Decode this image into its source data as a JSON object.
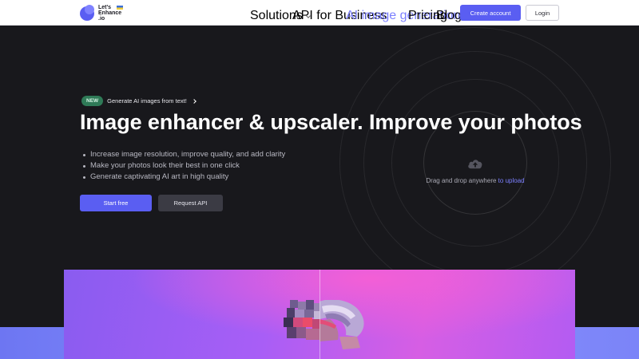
{
  "header": {
    "logo_text": "Let's\nEnhance\n.io",
    "nav": [
      {
        "label": "Solutions",
        "has_dropdown": true
      },
      {
        "label": "API for Business"
      },
      {
        "label": "AI image generation",
        "active": true
      },
      {
        "label": "Pricing"
      },
      {
        "label": "Blog"
      }
    ],
    "create_account": "Create account",
    "login": "Login"
  },
  "hero": {
    "badge": "NEW",
    "badge_text": "Generate AI images from text!",
    "headline": "Image enhancer & upscaler.  Improve your photos",
    "bullets": [
      "Increase image resolution, improve quality, and add clarity",
      "Make your photos look their best in one click",
      "Generate captivating AI art in high quality"
    ],
    "start_free": "Start free",
    "request_api": "Request API",
    "drag_text": "Drag and drop anywhere ",
    "upload_link": "to upload"
  },
  "colors": {
    "accent": "#5a5ef2",
    "link": "#7c80ff",
    "background_dark": "#18181c",
    "badge_green": "#2f7a57"
  },
  "icons": {
    "upload": "cloud-upload-icon",
    "badge_arrow": "chevron-right-icon",
    "dropdown": "chevron-down-icon"
  }
}
